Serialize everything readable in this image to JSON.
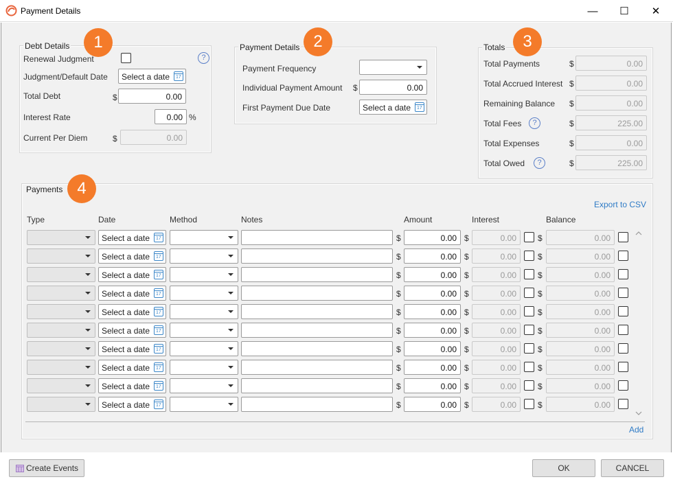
{
  "window": {
    "title": "Payment Details",
    "minimize": "—",
    "maximize": "☐",
    "close": "✕"
  },
  "badges": [
    "1",
    "2",
    "3",
    "4"
  ],
  "debt": {
    "legend": "Debt Details",
    "renewal_label": "Renewal Judgment",
    "judgment_date_label": "Judgment/Default Date",
    "judgment_date_placeholder": "Select a date",
    "total_debt_label": "Total Debt",
    "total_debt_value": "0.00",
    "interest_rate_label": "Interest Rate",
    "interest_rate_value": "0.00",
    "percent": "%",
    "per_diem_label": "Current Per Diem",
    "per_diem_value": "0.00"
  },
  "payment": {
    "legend": "Payment Details",
    "frequency_label": "Payment Frequency",
    "individual_label": "Individual Payment Amount",
    "individual_value": "0.00",
    "first_due_label": "First Payment Due Date",
    "first_due_placeholder": "Select a date"
  },
  "totals": {
    "legend": "Totals",
    "rows": [
      {
        "label": "Total Payments",
        "value": "0.00",
        "help": false
      },
      {
        "label": "Total Accrued Interest",
        "value": "0.00",
        "help": false
      },
      {
        "label": "Remaining Balance",
        "value": "0.00",
        "help": false
      },
      {
        "label": "Total Fees",
        "value": "225.00",
        "help": true
      },
      {
        "label": "Total Expenses",
        "value": "0.00",
        "help": false
      },
      {
        "label": "Total Owed",
        "value": "225.00",
        "help": true
      }
    ]
  },
  "payments": {
    "legend": "Payments",
    "export_label": "Export to CSV",
    "add_label": "Add",
    "columns": [
      "Type",
      "Date",
      "Method",
      "Notes",
      "Amount",
      "Interest",
      "Balance"
    ],
    "row_count": 10,
    "date_placeholder": "Select a date",
    "amount_value": "0.00",
    "interest_value": "0.00",
    "balance_value": "0.00"
  },
  "currency": "$",
  "help_glyph": "?",
  "footer": {
    "create_events": "Create Events",
    "ok": "OK",
    "cancel": "CANCEL"
  },
  "colors": {
    "badge": "#f47b2a",
    "link": "#2f7bc6",
    "help": "#5a7fc8"
  }
}
